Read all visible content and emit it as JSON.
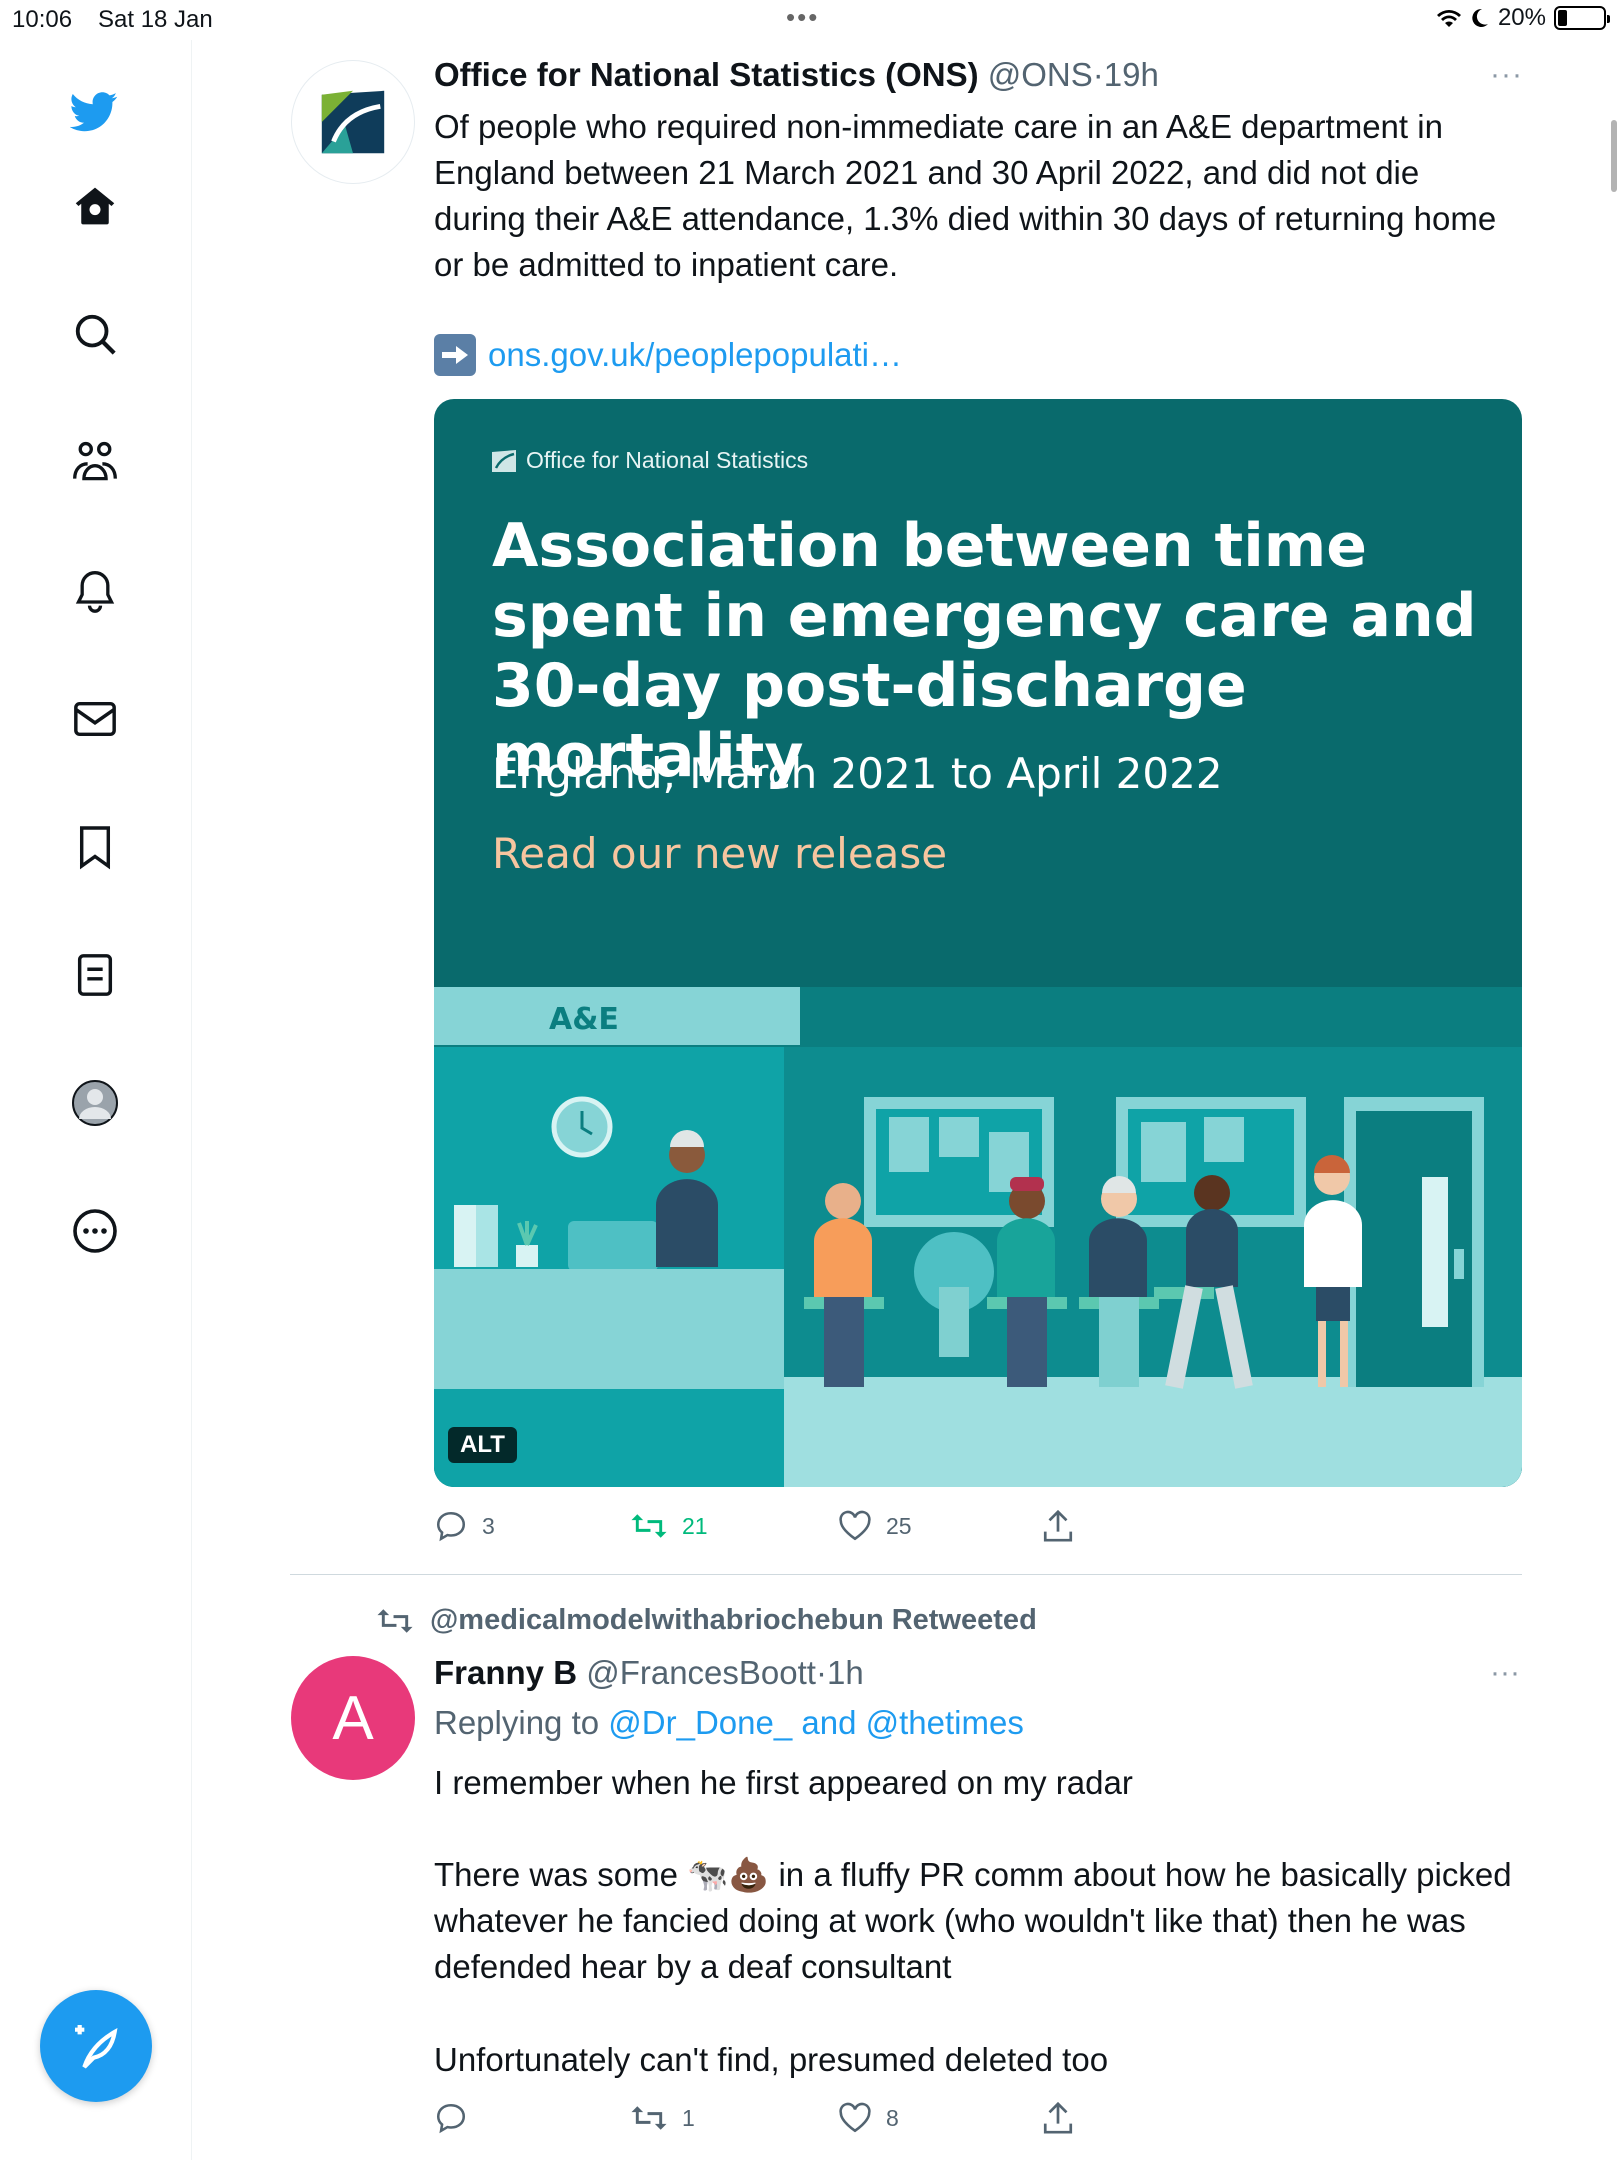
{
  "status_bar": {
    "time": "10:06",
    "date": "Sat 18 Jan",
    "battery_percent": "20%",
    "battery_level": 0.2
  },
  "sidebar": {
    "items": [
      "twitter-logo",
      "home",
      "search",
      "communities",
      "notifications",
      "messages",
      "bookmarks",
      "lists",
      "profile",
      "more"
    ]
  },
  "tweet1": {
    "name": "Office for National Statistics (ONS)",
    "handle": "@ONS",
    "sep": "·",
    "time": "19h",
    "more": "···",
    "body": "Of people who required non-immediate care in an A&E department in England between 21 March 2021 and 30 April 2022, and did not die during their A&E attendance, 1.3% died within 30 days of returning home or be admitted to inpatient care.",
    "link": "ons.gov.uk/peoplepopulati…",
    "media": {
      "org": "Office for National Statistics",
      "title": "Association between time spent in emergency care and 30-day post-discharge mortality",
      "subtitle": "England, March 2021 to April 2022",
      "cta": "Read our new release",
      "sign": "A&E",
      "alt_badge": "ALT"
    },
    "stats": {
      "replies": "3",
      "retweets": "21",
      "likes": "25"
    }
  },
  "tweet2": {
    "retweeted_by": "@medicalmodelwithabriochebun Retweeted",
    "avatar_letter": "A",
    "name": "Franny B",
    "handle": "@FrancesBoott",
    "sep": "·",
    "time": "1h",
    "more": "···",
    "replying_prefix": "Replying to",
    "replying_user1": "@Dr_Done_",
    "replying_and": "and",
    "replying_user2": "@thetimes",
    "p1": "I remember when he first appeared on my radar",
    "p2_start": "There was some",
    "p2_emoji": "🐄💩",
    "p2_rest": " in a fluffy PR comm about how he basically picked whatever he fancied doing at work (who wouldn't like that) then he was defended hear by a deaf consultant",
    "p3": "Unfortunately can't find, presumed deleted too",
    "stats": {
      "replies": "",
      "retweets": "1",
      "likes": "8"
    }
  },
  "colors": {
    "accent": "#1d9bf0",
    "retweet_green": "#00ba7c",
    "card_teal": "#096a6c",
    "cta_peach": "#f7c59f",
    "avatar_pink": "#e8397a"
  }
}
